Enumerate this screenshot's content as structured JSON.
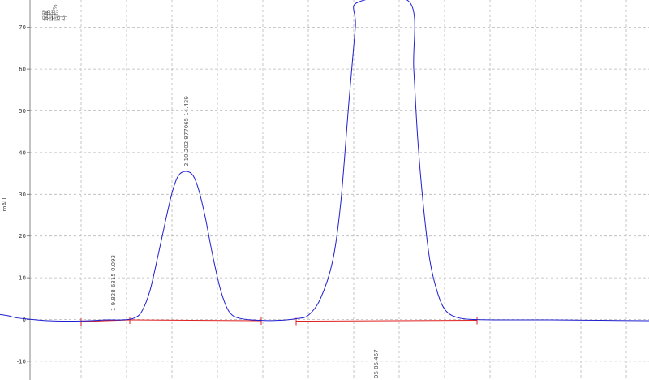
{
  "chart_data": {
    "type": "line",
    "title": "",
    "xlabel": "",
    "ylabel": "mAU",
    "ylim": [
      -15,
      75
    ],
    "y_ticks": [
      -10,
      0,
      10,
      20,
      30,
      40,
      50,
      60,
      70
    ],
    "grid": true,
    "legend": "none",
    "colors": {
      "signal": "#1f1fd0",
      "baseline": "#e02020",
      "grid": "#b8b8b8"
    },
    "corner_text": [
      "保留",
      "面积",
      "面积%",
      "分",
      "分"
    ],
    "peaks": [
      {
        "label": "1  9.828  6315  0.093"
      },
      {
        "label": "2  10.202  977065  14.439"
      },
      {
        "label": "06  85.467"
      }
    ],
    "series": [
      {
        "values": [
          [
            0,
            1.2
          ],
          [
            10,
            0.9
          ],
          [
            20,
            0.4
          ],
          [
            35,
            0.1
          ],
          [
            60,
            -0.3
          ],
          [
            90,
            -0.4
          ],
          [
            110,
            -0.3
          ],
          [
            130,
            -0.1
          ],
          [
            150,
            -0.1
          ],
          [
            165,
            0.3
          ],
          [
            175,
            2.0
          ],
          [
            185,
            7.0
          ],
          [
            195,
            15.5
          ],
          [
            205,
            24.5
          ],
          [
            213,
            31.0
          ],
          [
            220,
            34.5
          ],
          [
            229,
            35.5
          ],
          [
            238,
            34.5
          ],
          [
            245,
            31.0
          ],
          [
            253,
            24.5
          ],
          [
            262,
            15.5
          ],
          [
            272,
            7.0
          ],
          [
            282,
            2.0
          ],
          [
            295,
            0.3
          ],
          [
            320,
            -0.2
          ],
          [
            345,
            -0.2
          ],
          [
            365,
            0.2
          ],
          [
            380,
            1.0
          ],
          [
            395,
            5.0
          ],
          [
            410,
            14.0
          ],
          [
            420,
            28.0
          ],
          [
            430,
            52.0
          ],
          [
            438,
            70.0
          ],
          [
            441,
            76.0
          ],
          [
            505,
            76.0
          ],
          [
            510,
            60.0
          ],
          [
            515,
            43.0
          ],
          [
            522,
            27.0
          ],
          [
            530,
            14.0
          ],
          [
            540,
            6.0
          ],
          [
            550,
            2.0
          ],
          [
            565,
            0.4
          ],
          [
            585,
            0.0
          ],
          [
            620,
            -0.1
          ],
          [
            680,
            -0.1
          ],
          [
            740,
            -0.2
          ],
          [
            800,
            -0.3
          ]
        ]
      }
    ],
    "baselines": [
      [
        [
          100,
          -0.5
        ],
        [
          160,
          -0.1
        ]
      ],
      [
        [
          160,
          -0.1
        ],
        [
          322,
          -0.3
        ]
      ],
      [
        [
          365,
          -0.4
        ],
        [
          588,
          -0.2
        ]
      ]
    ]
  }
}
